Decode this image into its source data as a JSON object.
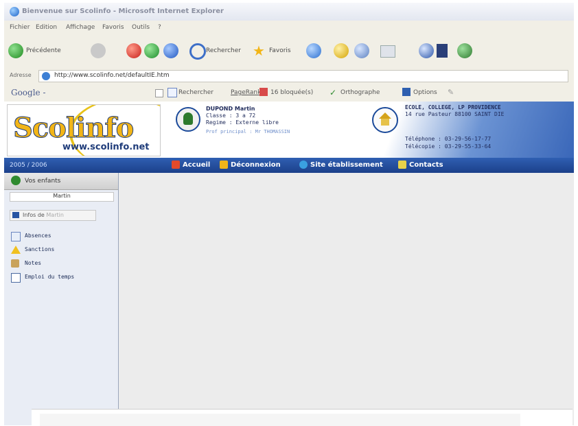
{
  "window": {
    "title": "Bienvenue sur Scolinfo - Microsoft Internet Explorer"
  },
  "menu": [
    "Fichier",
    "Edition",
    "Affichage",
    "Favoris",
    "Outils",
    "?"
  ],
  "toolbar": {
    "back_label": "Précédente",
    "search_label": "Rechercher",
    "favorites_label": "Favoris"
  },
  "address": {
    "label": "Adresse",
    "url": "http://www.scolinfo.net/defaultIE.htm"
  },
  "googlebar": {
    "logo": "Google -",
    "search_label": "Rechercher",
    "pagerank_label": "PageRank",
    "blocked_label": "16 bloquée(s)",
    "spell_label": "Orthographe",
    "options_label": "Options"
  },
  "header": {
    "logo_text": "Scolinfo",
    "logo_url": "www.scolinfo.net",
    "student": {
      "name": "DUPOND Martin",
      "classe": "Classe : 3 a 72",
      "regime": "Regime : Externe libre",
      "prof": "Prof principal : Mr THOMASSIN"
    },
    "school": {
      "name": "ECOLE, COLLEGE, LP PROVIDENCE",
      "address": "14 rue Pasteur 88100 SAINT DIE",
      "phone": "Téléphone : 03-29-56-17-77",
      "fax": "Télécopie : 03-29-55-33-64"
    }
  },
  "navbar": {
    "year": "2005 / 2006",
    "items": [
      "Accueil",
      "Déconnexion",
      "Site établissement",
      "Contacts"
    ]
  },
  "sidebar": {
    "kids_label": "Vos enfants",
    "child": "Martin",
    "infos_prefix": "Infos de",
    "infos_child": "Martin",
    "items": [
      "Absences",
      "Sanctions",
      "Notes",
      "Emploi du temps"
    ]
  },
  "colors": {
    "brand_yellow": "#f2b517",
    "brand_blue": "#1f3c7a",
    "nav_blue": "#2f5fb2"
  }
}
